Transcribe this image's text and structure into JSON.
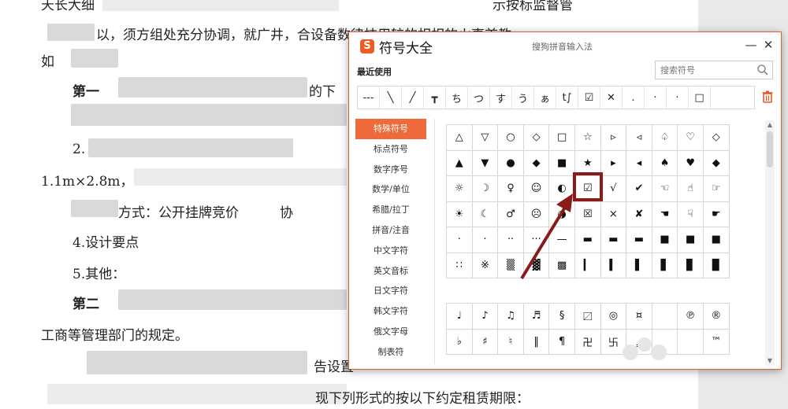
{
  "document": {
    "lines": [
      {
        "text": "",
        "blurred": true
      },
      {
        "text": "如",
        "blurred": false
      },
      {
        "text": "第一",
        "blurred": false
      },
      {
        "text": "2.",
        "blurred": false
      },
      {
        "text": "1.1m×2.8m，",
        "blurred": false
      },
      {
        "text": "方式：公开挂牌竞价",
        "blurred": false
      },
      {
        "text": "协",
        "blurred": false
      },
      {
        "text": "4.设计要点",
        "blurred": false
      },
      {
        "text": "5.其他：",
        "blurred": false
      },
      {
        "text": "第二",
        "blurred": false
      },
      {
        "text": "工商等管理部门的规定。",
        "blurred": false
      },
      {
        "text": "告设置",
        "blurred": false
      },
      {
        "text": "的下",
        "blurred": false
      }
    ]
  },
  "dialog": {
    "title": "符号大全",
    "subtitle": "搜狗拼音输入法",
    "logo_letter": "S",
    "minimize_label": "—",
    "close_label": "✕",
    "recent_label": "最近使用",
    "search_placeholder": "搜索符号",
    "recent_symbols": [
      "---",
      "╲",
      "╱",
      "┳",
      "ち",
      "つ",
      "す",
      "う",
      "ぁ",
      "t∫",
      "☑",
      "✕",
      ".",
      "·",
      "·",
      "□",
      ""
    ],
    "sidebar": [
      {
        "label": "特殊符号",
        "active": true
      },
      {
        "label": "标点符号",
        "active": false
      },
      {
        "label": "数字序号",
        "active": false
      },
      {
        "label": "数学/单位",
        "active": false
      },
      {
        "label": "希腊/拉丁",
        "active": false
      },
      {
        "label": "拼音/注音",
        "active": false
      },
      {
        "label": "中文字符",
        "active": false
      },
      {
        "label": "英文音标",
        "active": false
      },
      {
        "label": "日文字符",
        "active": false
      },
      {
        "label": "韩文字符",
        "active": false
      },
      {
        "label": "俄文字母",
        "active": false
      },
      {
        "label": "制表符",
        "active": false
      }
    ],
    "grid_main": [
      [
        "△",
        "▽",
        "○",
        "◇",
        "□",
        "☆",
        "▷",
        "◁",
        "♤",
        "♡",
        "◇",
        "♧"
      ],
      [
        "▲",
        "▼",
        "●",
        "◆",
        "■",
        "★",
        "▶",
        "◀",
        "♠",
        "♥",
        "◆",
        "♣"
      ],
      [
        "☼",
        "☽",
        "♀",
        "☺",
        "◐",
        "☑",
        "√",
        "✔",
        "☜",
        "☝",
        "☞",
        "㏂"
      ],
      [
        "☀",
        "☾",
        "♂",
        "☹",
        "◑",
        "☒",
        "×",
        "✘",
        "☚",
        "☟",
        "☛",
        "㏘"
      ],
      [
        "▁",
        "▂",
        "▃",
        "▄",
        "▅",
        "▆",
        "▇",
        "█",
        "▉",
        "▊",
        "▋",
        "▌"
      ],
      [
        "∷",
        "※",
        "▒",
        "▓",
        "▤",
        "▍",
        "▎",
        "▏",
        "▐",
        "▕",
        "▌",
        "▍"
      ]
    ],
    "grid_main_display": [
      [
        "△",
        "▽",
        "○",
        "◇",
        "□",
        "☆",
        "▹",
        "◃",
        "♤",
        "♡",
        "◇",
        "♧"
      ],
      [
        "▲",
        "▼",
        "●",
        "◆",
        "■",
        "★",
        "▸",
        "◂",
        "♠",
        "♥",
        "◆",
        "♣"
      ],
      [
        "☼",
        "☽",
        "♀",
        "☺",
        "◐",
        "☑",
        "√",
        "✔",
        "☜",
        "☝",
        "☞",
        "㏂"
      ],
      [
        "☀",
        "☾",
        "♂",
        "☹",
        "◑",
        "☒",
        "×",
        "✘",
        "☚",
        "☟",
        "☛",
        "㏘"
      ],
      [
        "·",
        "·",
        "··",
        "···",
        "—",
        "▬",
        "▬",
        "▬",
        "■",
        "■",
        "■"
      ],
      [
        "∷",
        "※",
        "▒",
        "▓",
        "▩",
        "▎",
        "▍",
        "▌",
        "▋",
        "▊",
        "▉"
      ]
    ],
    "grid_music": [
      [
        "♩",
        "♪",
        "♫",
        "♬",
        "§",
        "〼",
        "◎",
        "¤",
        "",
        "℗",
        "®",
        "©"
      ],
      [
        "♭",
        "♯",
        "♮",
        "‖",
        "¶",
        "卍",
        "卐",
        "‗",
        "",
        "",
        "™",
        "℅"
      ]
    ],
    "highlighted_symbol": "☑"
  }
}
